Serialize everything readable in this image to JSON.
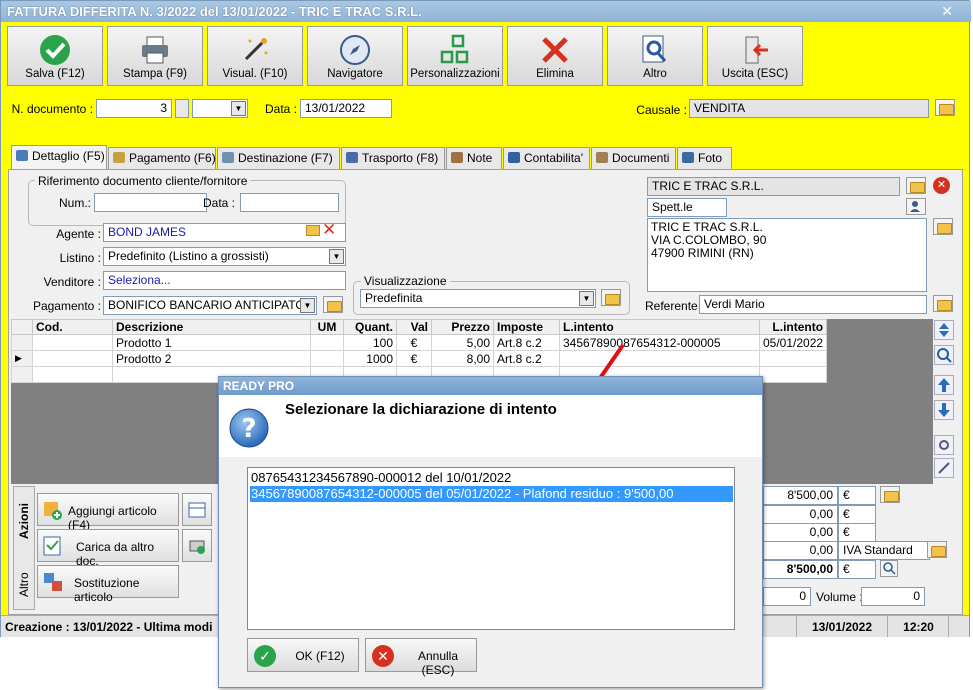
{
  "window": {
    "title": "FATTURA DIFFERITA N. 3/2022 del 13/01/2022 - TRIC E TRAC S.R.L.",
    "close": "✕"
  },
  "toolbar": [
    {
      "label": "Salva (F12)",
      "icon": "check-icon"
    },
    {
      "label": "Stampa (F9)",
      "icon": "printer-icon"
    },
    {
      "label": "Visual. (F10)",
      "icon": "magic-wand-icon"
    },
    {
      "label": "Navigatore",
      "icon": "compass-icon"
    },
    {
      "label": "Personalizzazioni",
      "icon": "customize-icon"
    },
    {
      "label": "Elimina",
      "icon": "delete-icon"
    },
    {
      "label": "Altro",
      "icon": "magnifier-icon"
    },
    {
      "label": "Uscita (ESC)",
      "icon": "exit-icon"
    }
  ],
  "doc": {
    "num_label": "N. documento :",
    "num_value": "3",
    "date_label": "Data :",
    "date_value": "13/01/2022",
    "causale_label": "Causale :",
    "causale_value": "VENDITA"
  },
  "tabs": [
    {
      "label": "Dettaglio (F5)",
      "color": "#4a7ab8"
    },
    {
      "label": "Pagamento (F6)",
      "color": "#c8a040"
    },
    {
      "label": "Destinazione (F7)",
      "color": "#7090b0"
    },
    {
      "label": "Trasporto (F8)",
      "color": "#4a6aa8"
    },
    {
      "label": "Note",
      "color": "#a07040"
    },
    {
      "label": "Contabilita'",
      "color": "#3060a0"
    },
    {
      "label": "Documenti",
      "color": "#a08050"
    },
    {
      "label": "Foto",
      "color": "#3a6aa0"
    }
  ],
  "rif": {
    "legend": "Riferimento documento cliente/fornitore",
    "num_label": "Num.:",
    "data_label": "Data :"
  },
  "form": {
    "agente_label": "Agente :",
    "agente_value": "BOND JAMES",
    "listino_label": "Listino :",
    "listino_value": "Predefinito (Listino a grossisti)",
    "venditore_label": "Venditore :",
    "venditore_value": "Seleziona...",
    "pagamento_label": "Pagamento :",
    "pagamento_value": "BONIFICO BANCARIO ANTICIPATO",
    "visual_legend": "Visualizzazione",
    "visual_value": "Predefinita"
  },
  "client": {
    "name": "TRIC E TRAC S.R.L.",
    "salutation": "Spett.le",
    "address_lines": [
      "TRIC E TRAC S.R.L.",
      "VIA C.COLOMBO, 90",
      "47900 RIMINI (RN)"
    ],
    "referente_label": "Referente",
    "referente_value": "Verdi Mario"
  },
  "grid": {
    "headers": [
      "Cod.",
      "Descrizione",
      "UM",
      "Quant.",
      "Val",
      "Prezzo",
      "Imposte",
      "L.intento",
      "L.intento"
    ],
    "rows": [
      [
        "",
        "Prodotto 1",
        "",
        "100",
        "€",
        "5,00",
        "Art.8 c.2",
        "34567890087654312-000005",
        "05/01/2022"
      ],
      [
        "",
        "Prodotto 2",
        "",
        "1000",
        "€",
        "8,00",
        "Art.8 c.2",
        "",
        ""
      ],
      [
        "",
        "",
        "",
        "",
        "",
        "",
        "",
        "",
        ""
      ]
    ]
  },
  "actions": {
    "tab_azioni": "Azioni",
    "tab_altro": "Altro",
    "buttons": [
      "Aggiungi articolo (F4)",
      "Carica da altro doc.",
      "Sostituzione articolo"
    ]
  },
  "totals": {
    "values": [
      "8'500,00",
      "0,00",
      "0,00",
      "0,00",
      "8'500,00"
    ],
    "units": [
      "€",
      "€",
      "€",
      "IVA Standard",
      "€"
    ],
    "colli_value": "0",
    "volume_label": "Volume :",
    "volume_value": "0"
  },
  "status": {
    "left": "Creazione : 13/01/2022 - Ultima modi",
    "date": "13/01/2022",
    "time": "12:20"
  },
  "dialog": {
    "title": "READY PRO",
    "heading": "Selezionare la dichiarazione di intento",
    "items": [
      "08765431234567890-000012 del 10/01/2022",
      "34567890087654312-000005 del 05/01/2022 - Plafond residuo : 9'500,00"
    ],
    "selected_index": 1,
    "ok_label": "OK (F12)",
    "cancel_label": "Annulla (ESC)"
  }
}
